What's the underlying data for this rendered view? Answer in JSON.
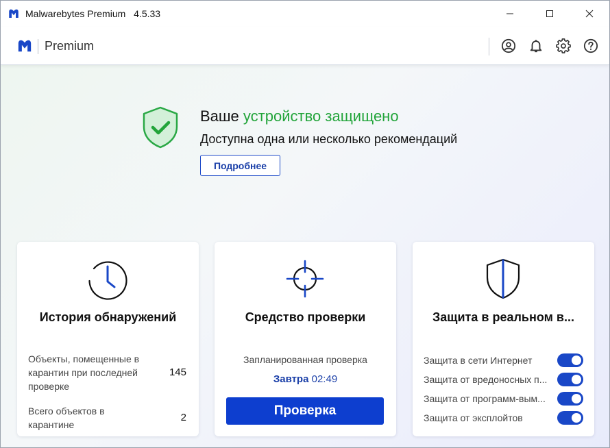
{
  "window": {
    "app_name": "Malwarebytes Premium",
    "version": "4.5.33"
  },
  "header": {
    "brand": "Premium",
    "icons": [
      "account-icon",
      "bell-icon",
      "gear-icon",
      "help-icon"
    ]
  },
  "status": {
    "title_prefix": "Ваше",
    "title_accent": "устройство защищено",
    "subtitle": "Доступна одна или несколько рекомендаций",
    "details_button": "Подробнее"
  },
  "cards": {
    "history": {
      "title": "История обнаружений",
      "stats": [
        {
          "label": "Объекты, помещенные в карантин при последней проверке",
          "value": "145"
        },
        {
          "label": "Всего объектов в карантине",
          "value": "2"
        }
      ]
    },
    "scanner": {
      "title": "Средство проверки",
      "schedule_label": "Запланированная проверка",
      "schedule_day": "Завтра",
      "schedule_time": "02:49",
      "scan_button": "Проверка"
    },
    "realtime": {
      "title": "Защита в реальном в...",
      "items": [
        {
          "label": "Защита в сети Интернет",
          "enabled": true
        },
        {
          "label": "Защита от вредоносных п...",
          "enabled": true
        },
        {
          "label": "Защита от программ-вым...",
          "enabled": true
        },
        {
          "label": "Защита от эксплойтов",
          "enabled": true
        }
      ]
    }
  },
  "colors": {
    "accent_green": "#22a43a",
    "brand_blue": "#0d3ecf",
    "link_blue": "#1a3fa8"
  }
}
